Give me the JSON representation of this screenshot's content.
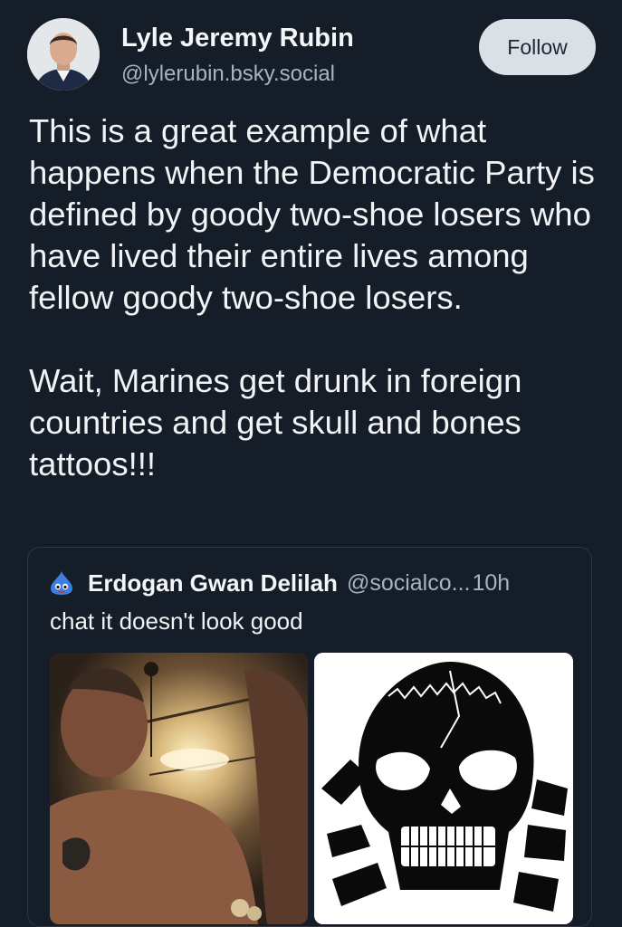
{
  "post": {
    "author": {
      "display_name": "Lyle Jeremy Rubin",
      "handle": "@lylerubin.bsky.social"
    },
    "follow_label": "Follow",
    "text_paragraphs": [
      "This is a great example of what happens when the Democratic Party is defined by goody two-shoe losers who have lived their entire lives among fellow goody two-shoe losers.",
      "Wait, Marines get drunk in foreign countries and get skull and bones tattoos!!!"
    ]
  },
  "quote": {
    "author": {
      "display_name": "Erdogan Gwan Delilah",
      "handle": "@socialco...",
      "avatar_icon": "blue-slime-icon"
    },
    "separator": " ",
    "timestamp": "10h",
    "text": "chat it doesn't look good",
    "images": [
      {
        "icon": "photo-shirtless-man"
      },
      {
        "icon": "skull-and-bones-emblem"
      }
    ]
  },
  "colors": {
    "background": "#151d28",
    "text_primary": "#f1f3f5",
    "text_secondary": "#a8b3c0",
    "follow_button_bg": "#dbe0e6",
    "card_border": "#2b3847",
    "slime_blue": "#3f7fe0"
  }
}
